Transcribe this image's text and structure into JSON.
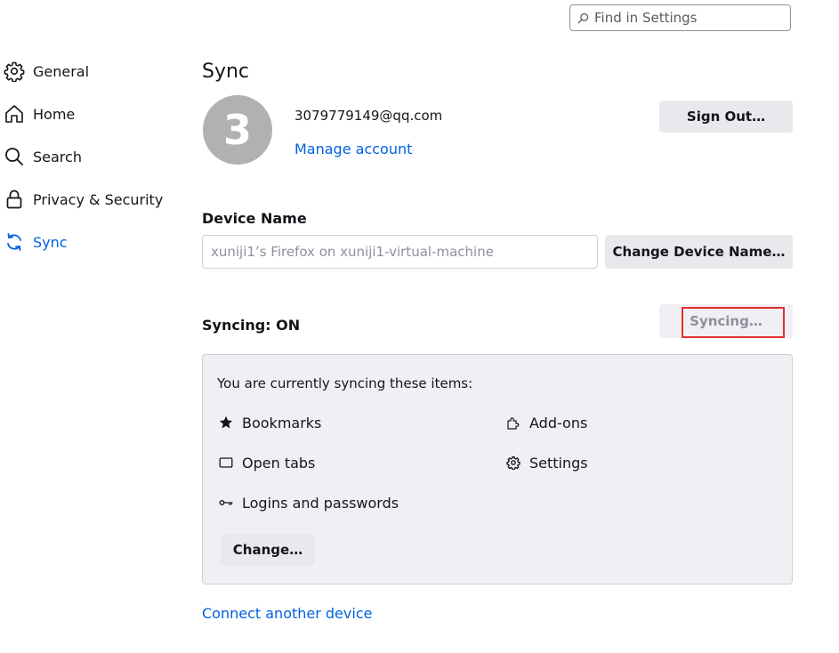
{
  "search": {
    "placeholder": "Find in Settings"
  },
  "sidebar": {
    "items": [
      {
        "label": "General",
        "icon": "gear-icon"
      },
      {
        "label": "Home",
        "icon": "home-icon"
      },
      {
        "label": "Search",
        "icon": "search-icon"
      },
      {
        "label": "Privacy & Security",
        "icon": "lock-icon"
      },
      {
        "label": "Sync",
        "icon": "sync-icon",
        "active": true
      }
    ]
  },
  "main": {
    "title": "Sync",
    "account": {
      "avatar_letter": "3",
      "email": "3079779149@qq.com",
      "manage_link": "Manage account",
      "sign_out_label": "Sign Out…"
    },
    "device": {
      "heading": "Device Name",
      "placeholder": "xuniji1’s Firefox on xuniji1-virtual-machine",
      "change_label": "Change Device Name…"
    },
    "sync": {
      "status": "Syncing: ON",
      "syncing_label": "Syncing…",
      "intro": "You are currently syncing these items:",
      "items": [
        {
          "label": "Bookmarks",
          "icon": "star-icon"
        },
        {
          "label": "Add-ons",
          "icon": "puzzle-icon"
        },
        {
          "label": "Open tabs",
          "icon": "tab-icon"
        },
        {
          "label": "Settings",
          "icon": "gear-icon"
        },
        {
          "label": "Logins and passwords",
          "icon": "key-icon"
        }
      ],
      "change_label": "Change…"
    },
    "connect_link": "Connect another device"
  },
  "colors": {
    "accent": "#0061e0",
    "button_bg": "#e9e9ed",
    "panel_bg": "#f0f0f4",
    "highlight": "#e22f2f"
  }
}
